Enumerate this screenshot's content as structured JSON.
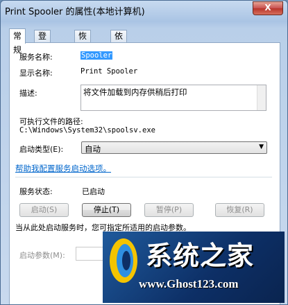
{
  "window": {
    "title": "Print Spooler 的属性(本地计算机)",
    "close_label": "X"
  },
  "tabs": [
    {
      "label": "常规",
      "active": true
    },
    {
      "label": "登录",
      "active": false
    },
    {
      "label": "恢复",
      "active": false
    },
    {
      "label": "依存关系",
      "active": false
    }
  ],
  "general": {
    "service_name_label": "服务名称:",
    "service_name_value": "Spooler",
    "display_name_label": "显示名称:",
    "display_name_value": "Print Spooler",
    "description_label": "描述:",
    "description_value": "将文件加载到内存供稍后打印",
    "exe_path_label": "可执行文件的路径:",
    "exe_path_value": "C:\\Windows\\System32\\spoolsv.exe",
    "startup_type_label": "启动类型(E):",
    "startup_type_value": "自动",
    "help_link": "帮助我配置服务启动选项。",
    "status_label": "服务状态:",
    "status_value": "已启动",
    "buttons": {
      "start": "启动(S)",
      "stop": "停止(T)",
      "pause": "暂停(P)",
      "resume": "恢复(R)"
    },
    "hint_text": "当从此处启动服务时，您可指定所适用的启动参数。",
    "start_params_label": "启动参数(M):"
  },
  "watermark": {
    "title": "系统之家",
    "url": "www.Ghost123.com",
    "colors": {
      "bg": "#0d2f66",
      "logo_yellow": "#f5c400",
      "logo_blue": "#2f8fe0"
    }
  }
}
